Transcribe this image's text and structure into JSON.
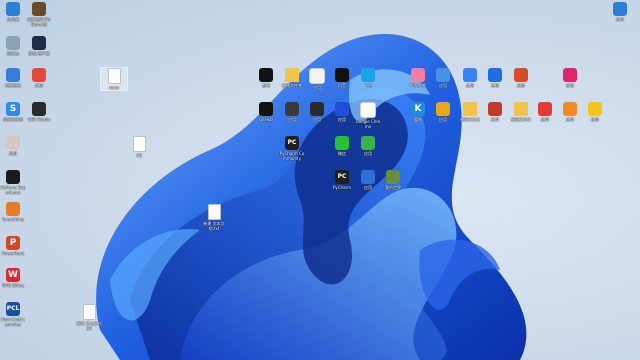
{
  "desktop": {
    "icons": [
      {
        "id": "this-pc",
        "label": "此电脑",
        "glyph": "",
        "color": "#2b7fd6",
        "icon": "monitor-icon"
      },
      {
        "id": "game-shortcut",
        "label": "英雄联盟 WeGame版",
        "glyph": "",
        "color": "#6b4a2b",
        "icon": "game-character-icon"
      },
      {
        "id": "recycle-bin",
        "label": "回收站",
        "glyph": "",
        "color": "#8aa2b8",
        "icon": "recycle-bin-icon"
      },
      {
        "id": "game-launcher",
        "label": "游戏 客户端",
        "glyph": "",
        "color": "#1e2e4a",
        "icon": "game-launcher-icon"
      },
      {
        "id": "control-panel",
        "label": "控制面板",
        "glyph": "",
        "color": "#3a7bd5",
        "icon": "control-panel-icon"
      },
      {
        "id": "app-red",
        "label": "应用",
        "glyph": "",
        "color": "#e04b3b",
        "icon": "red-app-icon"
      },
      {
        "id": "browser-s",
        "label": "搜狗浏览器",
        "glyph": "S",
        "color": "#2f8be6",
        "icon": "sogou-browser-icon"
      },
      {
        "id": "obs",
        "label": "OBS Studio",
        "glyph": "",
        "color": "#2a2a2a",
        "icon": "obs-studio-icon"
      },
      {
        "id": "avatar-app",
        "label": "应用",
        "glyph": "",
        "color": "#d7c7c3",
        "icon": "avatar-app-icon"
      },
      {
        "id": "nvidia",
        "label": "GeForce Experience",
        "glyph": "",
        "color": "#1a1a1a",
        "icon": "nvidia-icon"
      },
      {
        "id": "everything",
        "label": "Everything",
        "glyph": "",
        "color": "#e87a2a",
        "icon": "everything-search-icon"
      },
      {
        "id": "office-p",
        "label": "PowerPoint",
        "glyph": "P",
        "color": "#d24726",
        "icon": "powerpoint-icon"
      },
      {
        "id": "wps",
        "label": "WPS Office",
        "glyph": "W",
        "color": "#e0262e",
        "icon": "wps-office-icon"
      },
      {
        "id": "pcl",
        "label": "Plain Craft Launcher",
        "glyph": "PCL",
        "color": "#1b4fa0",
        "icon": "pcl-launcher-icon"
      },
      {
        "id": "file-a",
        "label": "aaaa",
        "glyph": "",
        "color": "",
        "icon": "text-file-icon"
      },
      {
        "id": "file-b",
        "label": "AB",
        "glyph": "",
        "color": "",
        "icon": "text-file-icon"
      },
      {
        "id": "file-c",
        "label": "新建 文本文档.txt",
        "glyph": "",
        "color": "",
        "icon": "text-file-icon"
      },
      {
        "id": "file-d",
        "label": "新建 文本文档(2)",
        "glyph": "",
        "color": "",
        "icon": "text-file-icon"
      },
      {
        "id": "capcut",
        "label": "剪映",
        "glyph": "",
        "color": "#111111",
        "icon": "capcut-icon"
      },
      {
        "id": "folder-1",
        "label": "新建文件夹",
        "glyph": "",
        "color": "#f3c24a",
        "icon": "folder-icon"
      },
      {
        "id": "app-colorful",
        "label": "应用",
        "glyph": "",
        "color": "#f2f2f2",
        "icon": "colorful-app-icon"
      },
      {
        "id": "tiktok",
        "label": "抖音",
        "glyph": "",
        "color": "#111111",
        "icon": "tiktok-icon"
      },
      {
        "id": "feishu",
        "label": "飞书",
        "glyph": "",
        "color": "#1aa3e8",
        "icon": "bird-app-icon"
      },
      {
        "id": "app-pink",
        "label": "哔哩哔哩",
        "glyph": "",
        "color": "#f07fa2",
        "icon": "pink-app-icon"
      },
      {
        "id": "app-blue",
        "label": "应用",
        "glyph": "",
        "color": "#4a90e2",
        "icon": "blue-app-icon"
      },
      {
        "id": "app-swirl",
        "label": "应用",
        "glyph": "",
        "color": "#3b82f6",
        "icon": "swirl-app-icon"
      },
      {
        "id": "app-pen",
        "label": "应用",
        "glyph": "",
        "color": "#1e6fe0",
        "icon": "pen-app-icon"
      },
      {
        "id": "app-orange",
        "label": "应用",
        "glyph": "",
        "color": "#d94a2a",
        "icon": "orange-app-icon"
      },
      {
        "id": "app-magenta",
        "label": "应用",
        "glyph": "",
        "color": "#e0246a",
        "icon": "magenta-app-icon"
      },
      {
        "id": "github",
        "label": "GitHub",
        "glyph": "",
        "color": "#111111",
        "icon": "github-icon"
      },
      {
        "id": "app-brush",
        "label": "应用",
        "glyph": "",
        "color": "#3a3a3a",
        "icon": "brush-app-icon"
      },
      {
        "id": "app-dark",
        "label": "应用",
        "glyph": "",
        "color": "#2a2a2a",
        "icon": "dark-app-icon"
      },
      {
        "id": "steam-like",
        "label": "应用",
        "glyph": "",
        "color": "#1d4fd8",
        "icon": "circle-app-icon"
      },
      {
        "id": "chrome",
        "label": "Google Chrome",
        "glyph": "",
        "color": "#ffffff",
        "icon": "chrome-icon"
      },
      {
        "id": "kugou",
        "label": "酷狗",
        "glyph": "K",
        "color": "#1e8de0",
        "icon": "kugou-icon"
      },
      {
        "id": "app-yellow",
        "label": "应用",
        "glyph": "",
        "color": "#e8a61d",
        "icon": "yellow-app-icon"
      },
      {
        "id": "folder-2",
        "label": "新建文件夹",
        "glyph": "",
        "color": "#f3c24a",
        "icon": "folder-icon"
      },
      {
        "id": "app-grid",
        "label": "应用",
        "glyph": "",
        "color": "#c0392b",
        "icon": "grid-app-icon"
      },
      {
        "id": "folder-3",
        "label": "新建文件夹",
        "glyph": "",
        "color": "#f3c24a",
        "icon": "folder-icon"
      },
      {
        "id": "app-red2",
        "label": "应用",
        "glyph": "",
        "color": "#e53935",
        "icon": "red-app-icon"
      },
      {
        "id": "app-orange2",
        "label": "应用",
        "glyph": "",
        "color": "#f08a24",
        "icon": "orange-app-icon"
      },
      {
        "id": "app-yellow2",
        "label": "应用",
        "glyph": "",
        "color": "#f5c518",
        "icon": "yellow-app-icon"
      },
      {
        "id": "pycharm-1",
        "label": "PyCharm Community",
        "glyph": "PC",
        "color": "#1f1f1f",
        "icon": "pycharm-icon"
      },
      {
        "id": "wechat",
        "label": "微信",
        "glyph": "",
        "color": "#2bbf3a",
        "icon": "wechat-icon"
      },
      {
        "id": "app-green",
        "label": "应用",
        "glyph": "",
        "color": "#3bb34a",
        "icon": "green-app-icon"
      },
      {
        "id": "pycharm-2",
        "label": "PyCharm",
        "glyph": "PC",
        "color": "#1f1f1f",
        "icon": "pycharm-icon"
      },
      {
        "id": "app-people",
        "label": "应用",
        "glyph": "",
        "color": "#2d6fd6",
        "icon": "people-app-icon"
      },
      {
        "id": "minecraft",
        "label": "我的世界",
        "glyph": "",
        "color": "#6a8f3a",
        "icon": "minecraft-icon"
      },
      {
        "id": "app-topright",
        "label": "应用",
        "glyph": "",
        "color": "#2b7fd6",
        "icon": "window-app-icon"
      }
    ]
  }
}
